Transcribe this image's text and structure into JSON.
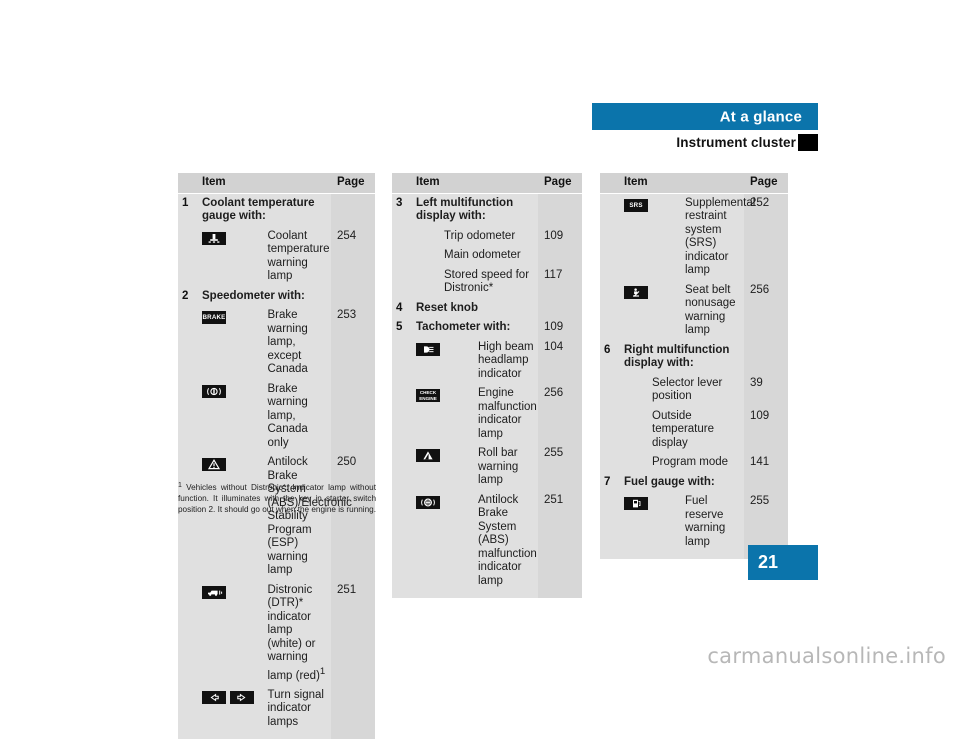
{
  "header": {
    "band_title": "At a glance",
    "sub_title": "Instrument cluster"
  },
  "page_number": "21",
  "watermark": "carmanualsonline.info",
  "column_headers": {
    "item": "Item",
    "page": "Page"
  },
  "columns": [
    {
      "rows": [
        {
          "num": "1",
          "icon": "",
          "item": "Coolant temperature gauge with:",
          "page": "",
          "bold": true
        },
        {
          "num": "",
          "icon": "coolant-temperature-icon",
          "item": "Coolant temperature warning lamp",
          "page": "254",
          "bold": false
        },
        {
          "num": "2",
          "icon": "",
          "item": "Speedometer with:",
          "page": "",
          "bold": true
        },
        {
          "num": "",
          "icon": "brake-warning-icon",
          "item": "Brake warning lamp, except Canada",
          "page": "253",
          "bold": false
        },
        {
          "num": "",
          "icon": "brake-warning-canada-icon",
          "item": "Brake warning lamp, Canada only",
          "page": "",
          "bold": false
        },
        {
          "num": "",
          "icon": "abs-esp-warning-icon",
          "item": "Antilock Brake System (ABS)/Electronic Stability Program (ESP) warning lamp",
          "page": "250",
          "bold": false
        },
        {
          "num": "",
          "icon": "distronic-indicator-icon",
          "item": "Distronic (DTR)* indicator lamp (white) or warning lamp (red)",
          "item_sup": "1",
          "page": "251",
          "bold": false
        },
        {
          "num": "",
          "icon": "turn-signal-icons",
          "item": "Turn signal indicator lamps",
          "page": "",
          "bold": false
        }
      ]
    },
    {
      "rows": [
        {
          "num": "3",
          "icon": "",
          "item": "Left multifunction display with:",
          "page": "",
          "bold": true
        },
        {
          "num": "",
          "icon": "",
          "item": "Trip odometer",
          "page": "109",
          "bold": false,
          "indent": true
        },
        {
          "num": "",
          "icon": "",
          "item": "Main odometer",
          "page": "",
          "bold": false,
          "indent": true
        },
        {
          "num": "",
          "icon": "",
          "item": "Stored speed for Distronic*",
          "page": "117",
          "bold": false,
          "indent": true
        },
        {
          "num": "4",
          "icon": "",
          "item": "Reset knob",
          "page": "",
          "bold": true
        },
        {
          "num": "5",
          "icon": "",
          "item": "Tachometer with:",
          "page": "109",
          "bold": true
        },
        {
          "num": "",
          "icon": "high-beam-icon",
          "item": "High beam headlamp indicator",
          "page": "104",
          "bold": false
        },
        {
          "num": "",
          "icon": "check-engine-icon",
          "item": "Engine malfunction indicator lamp",
          "page": "256",
          "bold": false
        },
        {
          "num": "",
          "icon": "roll-bar-warning-icon",
          "item": "Roll bar warning lamp",
          "page": "255",
          "bold": false
        },
        {
          "num": "",
          "icon": "abs-malfunction-icon",
          "item": "Antilock Brake System (ABS) malfunction indicator lamp",
          "page": "251",
          "bold": false
        }
      ]
    },
    {
      "rows": [
        {
          "num": "",
          "icon": "srs-indicator-icon",
          "item": "Supplemental restraint system (SRS) indicator lamp",
          "page": "252",
          "bold": false
        },
        {
          "num": "",
          "icon": "seat-belt-icon",
          "item": "Seat belt nonusage warning lamp",
          "page": "256",
          "bold": false
        },
        {
          "num": "6",
          "icon": "",
          "item": "Right multifunction display with:",
          "page": "",
          "bold": true
        },
        {
          "num": "",
          "icon": "",
          "item": "Selector lever position",
          "page": "39",
          "bold": false,
          "indent": true
        },
        {
          "num": "",
          "icon": "",
          "item": "Outside temperature display",
          "page": "109",
          "bold": false,
          "indent": true
        },
        {
          "num": "",
          "icon": "",
          "item": "Program mode",
          "page": "141",
          "bold": false,
          "indent": true
        },
        {
          "num": "7",
          "icon": "",
          "item": "Fuel gauge with:",
          "page": "",
          "bold": true
        },
        {
          "num": "",
          "icon": "fuel-reserve-icon",
          "item": "Fuel reserve warning lamp",
          "page": "255",
          "bold": false
        }
      ]
    }
  ],
  "footnote": {
    "marker": "1",
    "text": "Vehicles without Distronic*: Indicator lamp without function. It illuminates with the key in starter switch position 2. It should go out when the engine is running."
  },
  "colors": {
    "accent_blue": "#0b74ab",
    "table_bg": "#e0e0e0",
    "table_header_bg": "#d2d2d2",
    "page_col_bg": "#d7d7d7",
    "icon_black": "#111111"
  }
}
